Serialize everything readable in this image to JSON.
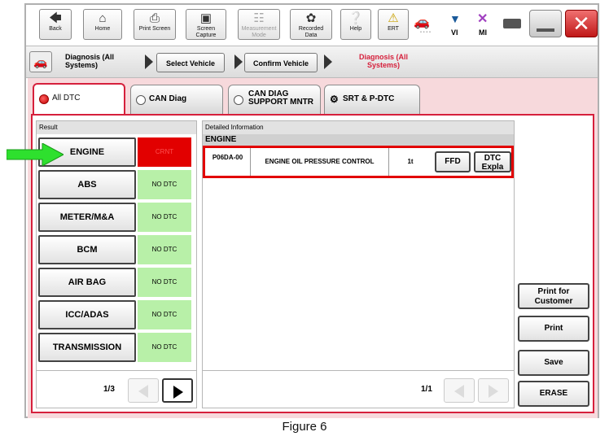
{
  "toolbar": {
    "back": "Back",
    "home": "Home",
    "print_screen": "Print Screen",
    "screen_capture": "Screen Capture",
    "measurement_mode": "Measurement Mode",
    "recorded_data": "Recorded Data",
    "help": "Help",
    "ert": "ERT",
    "vi": "VI",
    "mi": "MI"
  },
  "breadcrumb": {
    "home": "Diagnosis (All Systems)",
    "select_vehicle": "Select Vehicle",
    "confirm_vehicle": "Confirm Vehicle",
    "current": "Diagnosis (All Systems)"
  },
  "tabs": [
    {
      "label": "All DTC"
    },
    {
      "label": "CAN Diag"
    },
    {
      "label": "CAN DIAG SUPPORT MNTR"
    },
    {
      "label": "SRT & P-DTC"
    }
  ],
  "result": {
    "header": "Result",
    "systems": [
      {
        "name": "ENGINE",
        "status": "CRNT"
      },
      {
        "name": "ABS",
        "status": "NO DTC"
      },
      {
        "name": "METER/M&A",
        "status": "NO DTC"
      },
      {
        "name": "BCM",
        "status": "NO DTC"
      },
      {
        "name": "AIR BAG",
        "status": "NO DTC"
      },
      {
        "name": "ICC/ADAS",
        "status": "NO DTC"
      },
      {
        "name": "TRANSMISSION",
        "status": "NO DTC"
      }
    ],
    "page": "1/3"
  },
  "detail": {
    "header": "Detailed Information",
    "system": "ENGINE",
    "dtc_code": "P06DA-00",
    "dtc_desc": "ENGINE OIL PRESSURE CONTROL",
    "status": "1t",
    "ffd": "FFD",
    "dtc_expla": "DTC Expla",
    "page": "1/1"
  },
  "actions": {
    "print_customer": "Print for Customer",
    "print": "Print",
    "save": "Save",
    "erase": "ERASE"
  },
  "caption": "Figure 6",
  "colors": {
    "accent_red": "#d6203c",
    "crnt_red": "#e20000",
    "no_dtc_green": "#b8f0a8",
    "arrow_green": "#2ee02e"
  }
}
